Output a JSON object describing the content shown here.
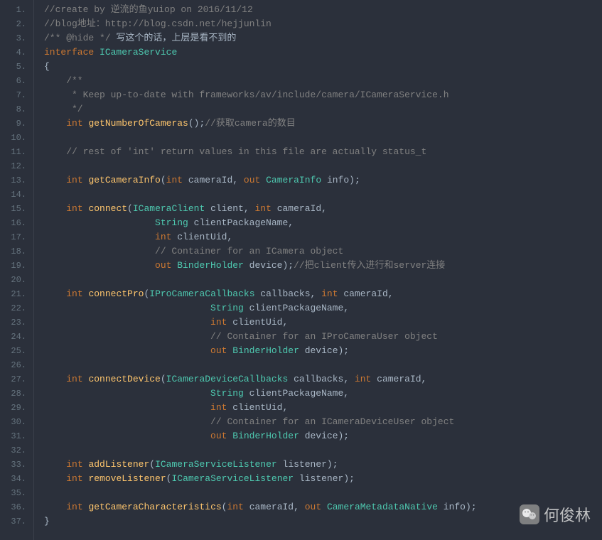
{
  "lines": [
    {
      "n": "1.",
      "segs": [
        {
          "t": "//create by 逆流的鱼yuiop on 2016/11/12",
          "c": "c-comment"
        }
      ]
    },
    {
      "n": "2.",
      "segs": [
        {
          "t": "//blog地址：http://blog.csdn.net/hejjunlin",
          "c": "c-comment"
        }
      ]
    },
    {
      "n": "3.",
      "segs": [
        {
          "t": "/** @hide */",
          "c": "c-comment"
        },
        {
          "t": " 写这个的话，上层是看不到的",
          "c": "c-param"
        }
      ]
    },
    {
      "n": "4.",
      "segs": [
        {
          "t": "interface",
          "c": "c-keyword"
        },
        {
          "t": " ",
          "c": ""
        },
        {
          "t": "ICameraService",
          "c": "c-cls"
        }
      ]
    },
    {
      "n": "5.",
      "segs": [
        {
          "t": "{",
          "c": "c-brace"
        }
      ]
    },
    {
      "n": "6.",
      "segs": [
        {
          "t": "    /**",
          "c": "c-comment"
        }
      ]
    },
    {
      "n": "7.",
      "segs": [
        {
          "t": "     * Keep up-to-date with frameworks/av/include/camera/ICameraService.h",
          "c": "c-comment"
        }
      ]
    },
    {
      "n": "8.",
      "segs": [
        {
          "t": "     */",
          "c": "c-comment"
        }
      ]
    },
    {
      "n": "9.",
      "segs": [
        {
          "t": "    ",
          "c": ""
        },
        {
          "t": "int",
          "c": "c-keyword"
        },
        {
          "t": " ",
          "c": ""
        },
        {
          "t": "getNumberOfCameras",
          "c": "c-method"
        },
        {
          "t": "();",
          "c": "c-punct"
        },
        {
          "t": "//获取camera的数目",
          "c": "c-comment"
        }
      ]
    },
    {
      "n": "10.",
      "segs": []
    },
    {
      "n": "11.",
      "segs": [
        {
          "t": "    // rest of 'int' return values in this file are actually status_t",
          "c": "c-comment"
        }
      ]
    },
    {
      "n": "12.",
      "segs": []
    },
    {
      "n": "13.",
      "segs": [
        {
          "t": "    ",
          "c": ""
        },
        {
          "t": "int",
          "c": "c-keyword"
        },
        {
          "t": " ",
          "c": ""
        },
        {
          "t": "getCameraInfo",
          "c": "c-method"
        },
        {
          "t": "(",
          "c": "c-punct"
        },
        {
          "t": "int",
          "c": "c-keyword"
        },
        {
          "t": " cameraId, ",
          "c": "c-param"
        },
        {
          "t": "out",
          "c": "c-keyword"
        },
        {
          "t": " ",
          "c": ""
        },
        {
          "t": "CameraInfo",
          "c": "c-cls"
        },
        {
          "t": " info);",
          "c": "c-param"
        }
      ]
    },
    {
      "n": "14.",
      "segs": []
    },
    {
      "n": "15.",
      "segs": [
        {
          "t": "    ",
          "c": ""
        },
        {
          "t": "int",
          "c": "c-keyword"
        },
        {
          "t": " ",
          "c": ""
        },
        {
          "t": "connect",
          "c": "c-method"
        },
        {
          "t": "(",
          "c": "c-punct"
        },
        {
          "t": "ICameraClient",
          "c": "c-cls"
        },
        {
          "t": " client, ",
          "c": "c-param"
        },
        {
          "t": "int",
          "c": "c-keyword"
        },
        {
          "t": " cameraId,",
          "c": "c-param"
        }
      ]
    },
    {
      "n": "16.",
      "segs": [
        {
          "t": "                    ",
          "c": ""
        },
        {
          "t": "String",
          "c": "c-cls"
        },
        {
          "t": " clientPackageName,",
          "c": "c-param"
        }
      ]
    },
    {
      "n": "17.",
      "segs": [
        {
          "t": "                    ",
          "c": ""
        },
        {
          "t": "int",
          "c": "c-keyword"
        },
        {
          "t": " clientUid,",
          "c": "c-param"
        }
      ]
    },
    {
      "n": "18.",
      "segs": [
        {
          "t": "                    // Container for an ICamera object",
          "c": "c-comment"
        }
      ]
    },
    {
      "n": "19.",
      "segs": [
        {
          "t": "                    ",
          "c": ""
        },
        {
          "t": "out",
          "c": "c-keyword"
        },
        {
          "t": " ",
          "c": ""
        },
        {
          "t": "BinderHolder",
          "c": "c-cls"
        },
        {
          "t": " device);",
          "c": "c-param"
        },
        {
          "t": "//把client传入进行和server连接",
          "c": "c-comment"
        }
      ]
    },
    {
      "n": "20.",
      "segs": []
    },
    {
      "n": "21.",
      "segs": [
        {
          "t": "    ",
          "c": ""
        },
        {
          "t": "int",
          "c": "c-keyword"
        },
        {
          "t": " ",
          "c": ""
        },
        {
          "t": "connectPro",
          "c": "c-method"
        },
        {
          "t": "(",
          "c": "c-punct"
        },
        {
          "t": "IProCameraCallbacks",
          "c": "c-cls"
        },
        {
          "t": " callbacks, ",
          "c": "c-param"
        },
        {
          "t": "int",
          "c": "c-keyword"
        },
        {
          "t": " cameraId,",
          "c": "c-param"
        }
      ]
    },
    {
      "n": "22.",
      "segs": [
        {
          "t": "                              ",
          "c": ""
        },
        {
          "t": "String",
          "c": "c-cls"
        },
        {
          "t": " clientPackageName,",
          "c": "c-param"
        }
      ]
    },
    {
      "n": "23.",
      "segs": [
        {
          "t": "                              ",
          "c": ""
        },
        {
          "t": "int",
          "c": "c-keyword"
        },
        {
          "t": " clientUid,",
          "c": "c-param"
        }
      ]
    },
    {
      "n": "24.",
      "segs": [
        {
          "t": "                              // Container for an IProCameraUser object",
          "c": "c-comment"
        }
      ]
    },
    {
      "n": "25.",
      "segs": [
        {
          "t": "                              ",
          "c": ""
        },
        {
          "t": "out",
          "c": "c-keyword"
        },
        {
          "t": " ",
          "c": ""
        },
        {
          "t": "BinderHolder",
          "c": "c-cls"
        },
        {
          "t": " device);",
          "c": "c-param"
        }
      ]
    },
    {
      "n": "26.",
      "segs": []
    },
    {
      "n": "27.",
      "segs": [
        {
          "t": "    ",
          "c": ""
        },
        {
          "t": "int",
          "c": "c-keyword"
        },
        {
          "t": " ",
          "c": ""
        },
        {
          "t": "connectDevice",
          "c": "c-method"
        },
        {
          "t": "(",
          "c": "c-punct"
        },
        {
          "t": "ICameraDeviceCallbacks",
          "c": "c-cls"
        },
        {
          "t": " callbacks, ",
          "c": "c-param"
        },
        {
          "t": "int",
          "c": "c-keyword"
        },
        {
          "t": " cameraId,",
          "c": "c-param"
        }
      ]
    },
    {
      "n": "28.",
      "segs": [
        {
          "t": "                              ",
          "c": ""
        },
        {
          "t": "String",
          "c": "c-cls"
        },
        {
          "t": " clientPackageName,",
          "c": "c-param"
        }
      ]
    },
    {
      "n": "29.",
      "segs": [
        {
          "t": "                              ",
          "c": ""
        },
        {
          "t": "int",
          "c": "c-keyword"
        },
        {
          "t": " clientUid,",
          "c": "c-param"
        }
      ]
    },
    {
      "n": "30.",
      "segs": [
        {
          "t": "                              // Container for an ICameraDeviceUser object",
          "c": "c-comment"
        }
      ]
    },
    {
      "n": "31.",
      "segs": [
        {
          "t": "                              ",
          "c": ""
        },
        {
          "t": "out",
          "c": "c-keyword"
        },
        {
          "t": " ",
          "c": ""
        },
        {
          "t": "BinderHolder",
          "c": "c-cls"
        },
        {
          "t": " device);",
          "c": "c-param"
        }
      ]
    },
    {
      "n": "32.",
      "segs": []
    },
    {
      "n": "33.",
      "segs": [
        {
          "t": "    ",
          "c": ""
        },
        {
          "t": "int",
          "c": "c-keyword"
        },
        {
          "t": " ",
          "c": ""
        },
        {
          "t": "addListener",
          "c": "c-method"
        },
        {
          "t": "(",
          "c": "c-punct"
        },
        {
          "t": "ICameraServiceListener",
          "c": "c-cls"
        },
        {
          "t": " listener);",
          "c": "c-param"
        }
      ]
    },
    {
      "n": "34.",
      "segs": [
        {
          "t": "    ",
          "c": ""
        },
        {
          "t": "int",
          "c": "c-keyword"
        },
        {
          "t": " ",
          "c": ""
        },
        {
          "t": "removeListener",
          "c": "c-method"
        },
        {
          "t": "(",
          "c": "c-punct"
        },
        {
          "t": "ICameraServiceListener",
          "c": "c-cls"
        },
        {
          "t": " listener);",
          "c": "c-param"
        }
      ]
    },
    {
      "n": "35.",
      "segs": []
    },
    {
      "n": "36.",
      "segs": [
        {
          "t": "    ",
          "c": ""
        },
        {
          "t": "int",
          "c": "c-keyword"
        },
        {
          "t": " ",
          "c": ""
        },
        {
          "t": "getCameraCharacteristics",
          "c": "c-method"
        },
        {
          "t": "(",
          "c": "c-punct"
        },
        {
          "t": "int",
          "c": "c-keyword"
        },
        {
          "t": " cameraId, ",
          "c": "c-param"
        },
        {
          "t": "out",
          "c": "c-keyword"
        },
        {
          "t": " ",
          "c": ""
        },
        {
          "t": "CameraMetadataNative",
          "c": "c-cls"
        },
        {
          "t": " info);",
          "c": "c-param"
        }
      ]
    },
    {
      "n": "37.",
      "segs": [
        {
          "t": "}",
          "c": "c-brace"
        }
      ]
    }
  ],
  "watermark": {
    "icon": "●●",
    "text": "何俊林"
  }
}
